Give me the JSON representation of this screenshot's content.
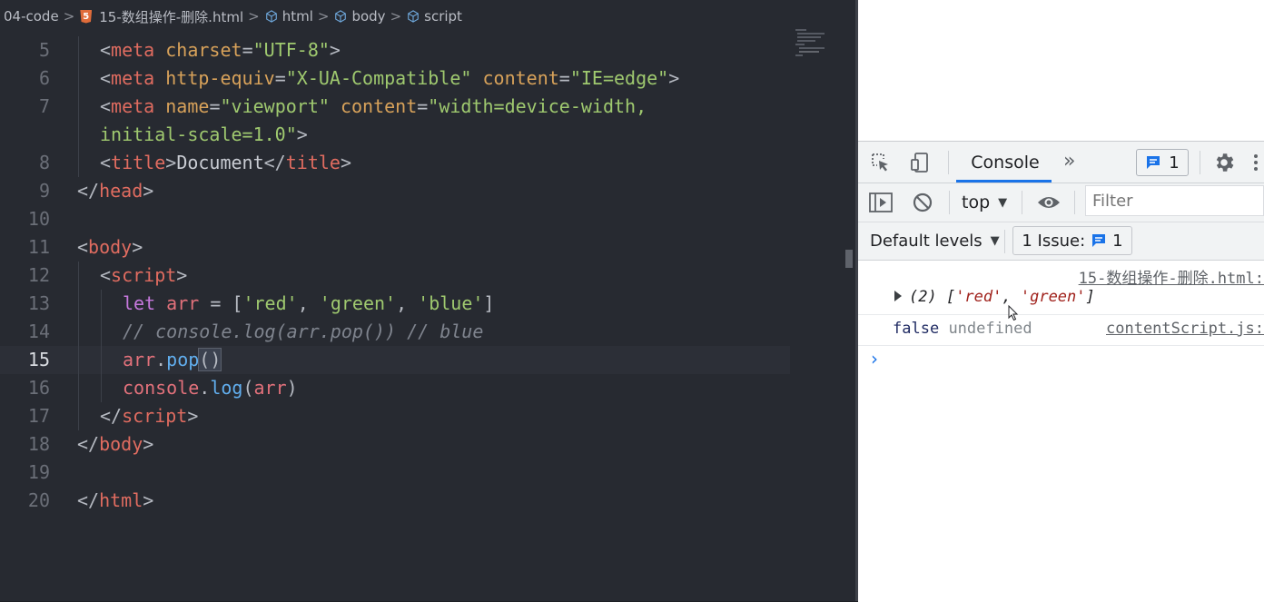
{
  "breadcrumb": {
    "items": [
      "04-code",
      "15-数组操作-删除.html",
      "html",
      "body",
      "script"
    ]
  },
  "editor": {
    "current_line": "15",
    "lines": [
      {
        "num": "5"
      },
      {
        "num": "6"
      },
      {
        "num": "7"
      },
      {
        "num": ""
      },
      {
        "num": "8"
      },
      {
        "num": "9"
      },
      {
        "num": "10"
      },
      {
        "num": "11"
      },
      {
        "num": "12"
      },
      {
        "num": "13"
      },
      {
        "num": "14"
      },
      {
        "num": "15"
      },
      {
        "num": "16"
      },
      {
        "num": "17"
      },
      {
        "num": "18"
      },
      {
        "num": "19"
      },
      {
        "num": "20"
      }
    ],
    "code": {
      "l5_tag": "meta",
      "l5_attr": "charset",
      "l5_val": "\"UTF-8\"",
      "l6_tag": "meta",
      "l6_attr1": "http-equiv",
      "l6_val1": "\"X-UA-Compatible\"",
      "l6_attr2": "content",
      "l6_val2": "\"IE=edge\"",
      "l7_tag": "meta",
      "l7_attr1": "name",
      "l7_val1": "\"viewport\"",
      "l7_attr2": "content",
      "l7_val2a": "\"width=device-width,",
      "l7_val2b": "initial-scale=1.0\"",
      "l8_tag": "title",
      "l8_text": "Document",
      "l9_tag": "head",
      "l11_tag": "body",
      "l12_tag": "script",
      "l13_kw": "let",
      "l13_var": "arr",
      "l13_s1": "'red'",
      "l13_s2": "'green'",
      "l13_s3": "'blue'",
      "l14_comment": "// console.log(arr.pop()) // blue",
      "l15_var": "arr",
      "l15_fn": "pop",
      "l16_obj": "console",
      "l16_fn": "log",
      "l16_arg": "arr",
      "l17_tag": "script",
      "l18_tag": "body",
      "l20_tag": "html"
    }
  },
  "devtools": {
    "tab_console": "Console",
    "messages_count": "1",
    "context": "top",
    "filter_placeholder": "Filter",
    "levels": "Default levels",
    "issues_label": "1 Issue:",
    "issues_count": "1",
    "log": {
      "source1": "15-数组操作-删除.html:",
      "row1_prefix": "(2) [",
      "row1_s1": "'red'",
      "row1_sep": ", ",
      "row1_s2": "'green'",
      "row1_suffix": "]",
      "row2_false": "false",
      "row2_undef": "undefined",
      "source2": "contentScript.js:"
    },
    "prompt": "›"
  },
  "colors": {
    "editor_bg": "#272a31",
    "tag": "#e06c60",
    "attr": "#d8a25a",
    "string": "#9fc96f",
    "keyword": "#c678dd",
    "function": "#61aeee",
    "accent": "#1a73e8"
  }
}
